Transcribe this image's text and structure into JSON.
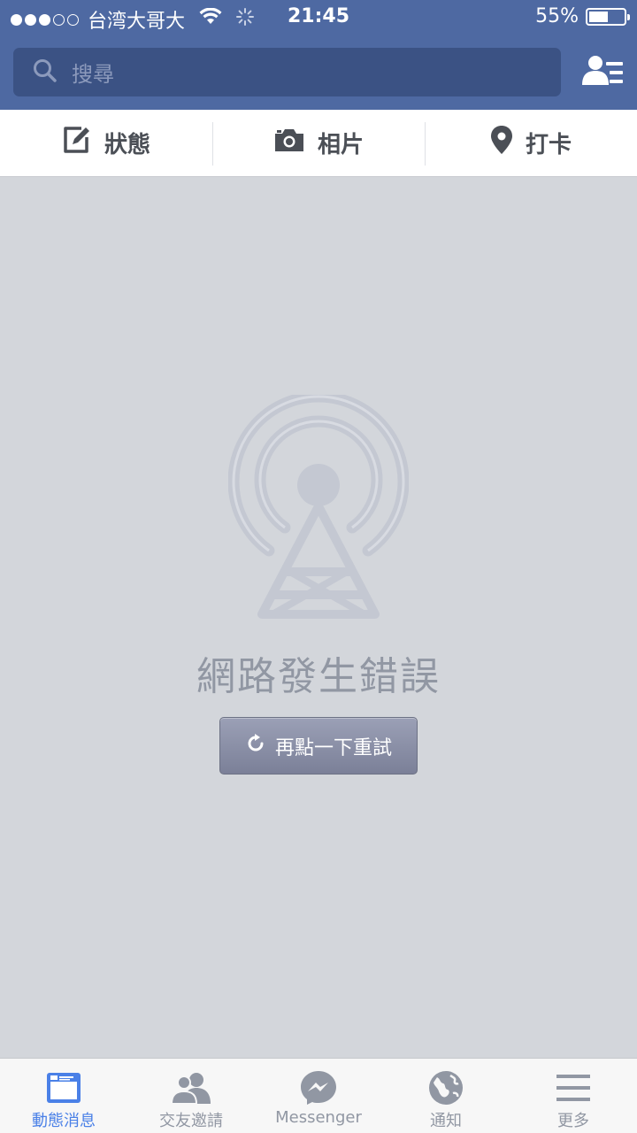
{
  "status_bar": {
    "carrier": "台湾大哥大",
    "time": "21:45",
    "battery_percent": "55%",
    "battery_level": 0.55,
    "signal_dots_filled": 3,
    "signal_dots_total": 5
  },
  "header": {
    "search_placeholder": "搜尋",
    "contacts_icon": "friends-list-icon"
  },
  "composer": {
    "items": [
      {
        "label": "狀態",
        "icon": "edit-icon"
      },
      {
        "label": "相片",
        "icon": "camera-icon"
      },
      {
        "label": "打卡",
        "icon": "location-pin-icon"
      }
    ]
  },
  "error": {
    "title": "網路發生錯誤",
    "retry_label": "再點一下重試",
    "icon": "broadcast-tower-icon"
  },
  "tabbar": {
    "tabs": [
      {
        "label": "動態消息",
        "icon": "news-feed-icon",
        "active": true
      },
      {
        "label": "交友邀請",
        "icon": "friend-requests-icon",
        "active": false
      },
      {
        "label": "Messenger",
        "icon": "messenger-icon",
        "active": false
      },
      {
        "label": "通知",
        "icon": "globe-icon",
        "active": false
      },
      {
        "label": "更多",
        "icon": "menu-icon",
        "active": false
      }
    ]
  },
  "colors": {
    "header_blue": "#4e69a2",
    "search_bg": "#3b5284",
    "content_bg": "#d3d6db",
    "active_tab": "#4a80e7",
    "inactive_tab": "#9197a3"
  }
}
